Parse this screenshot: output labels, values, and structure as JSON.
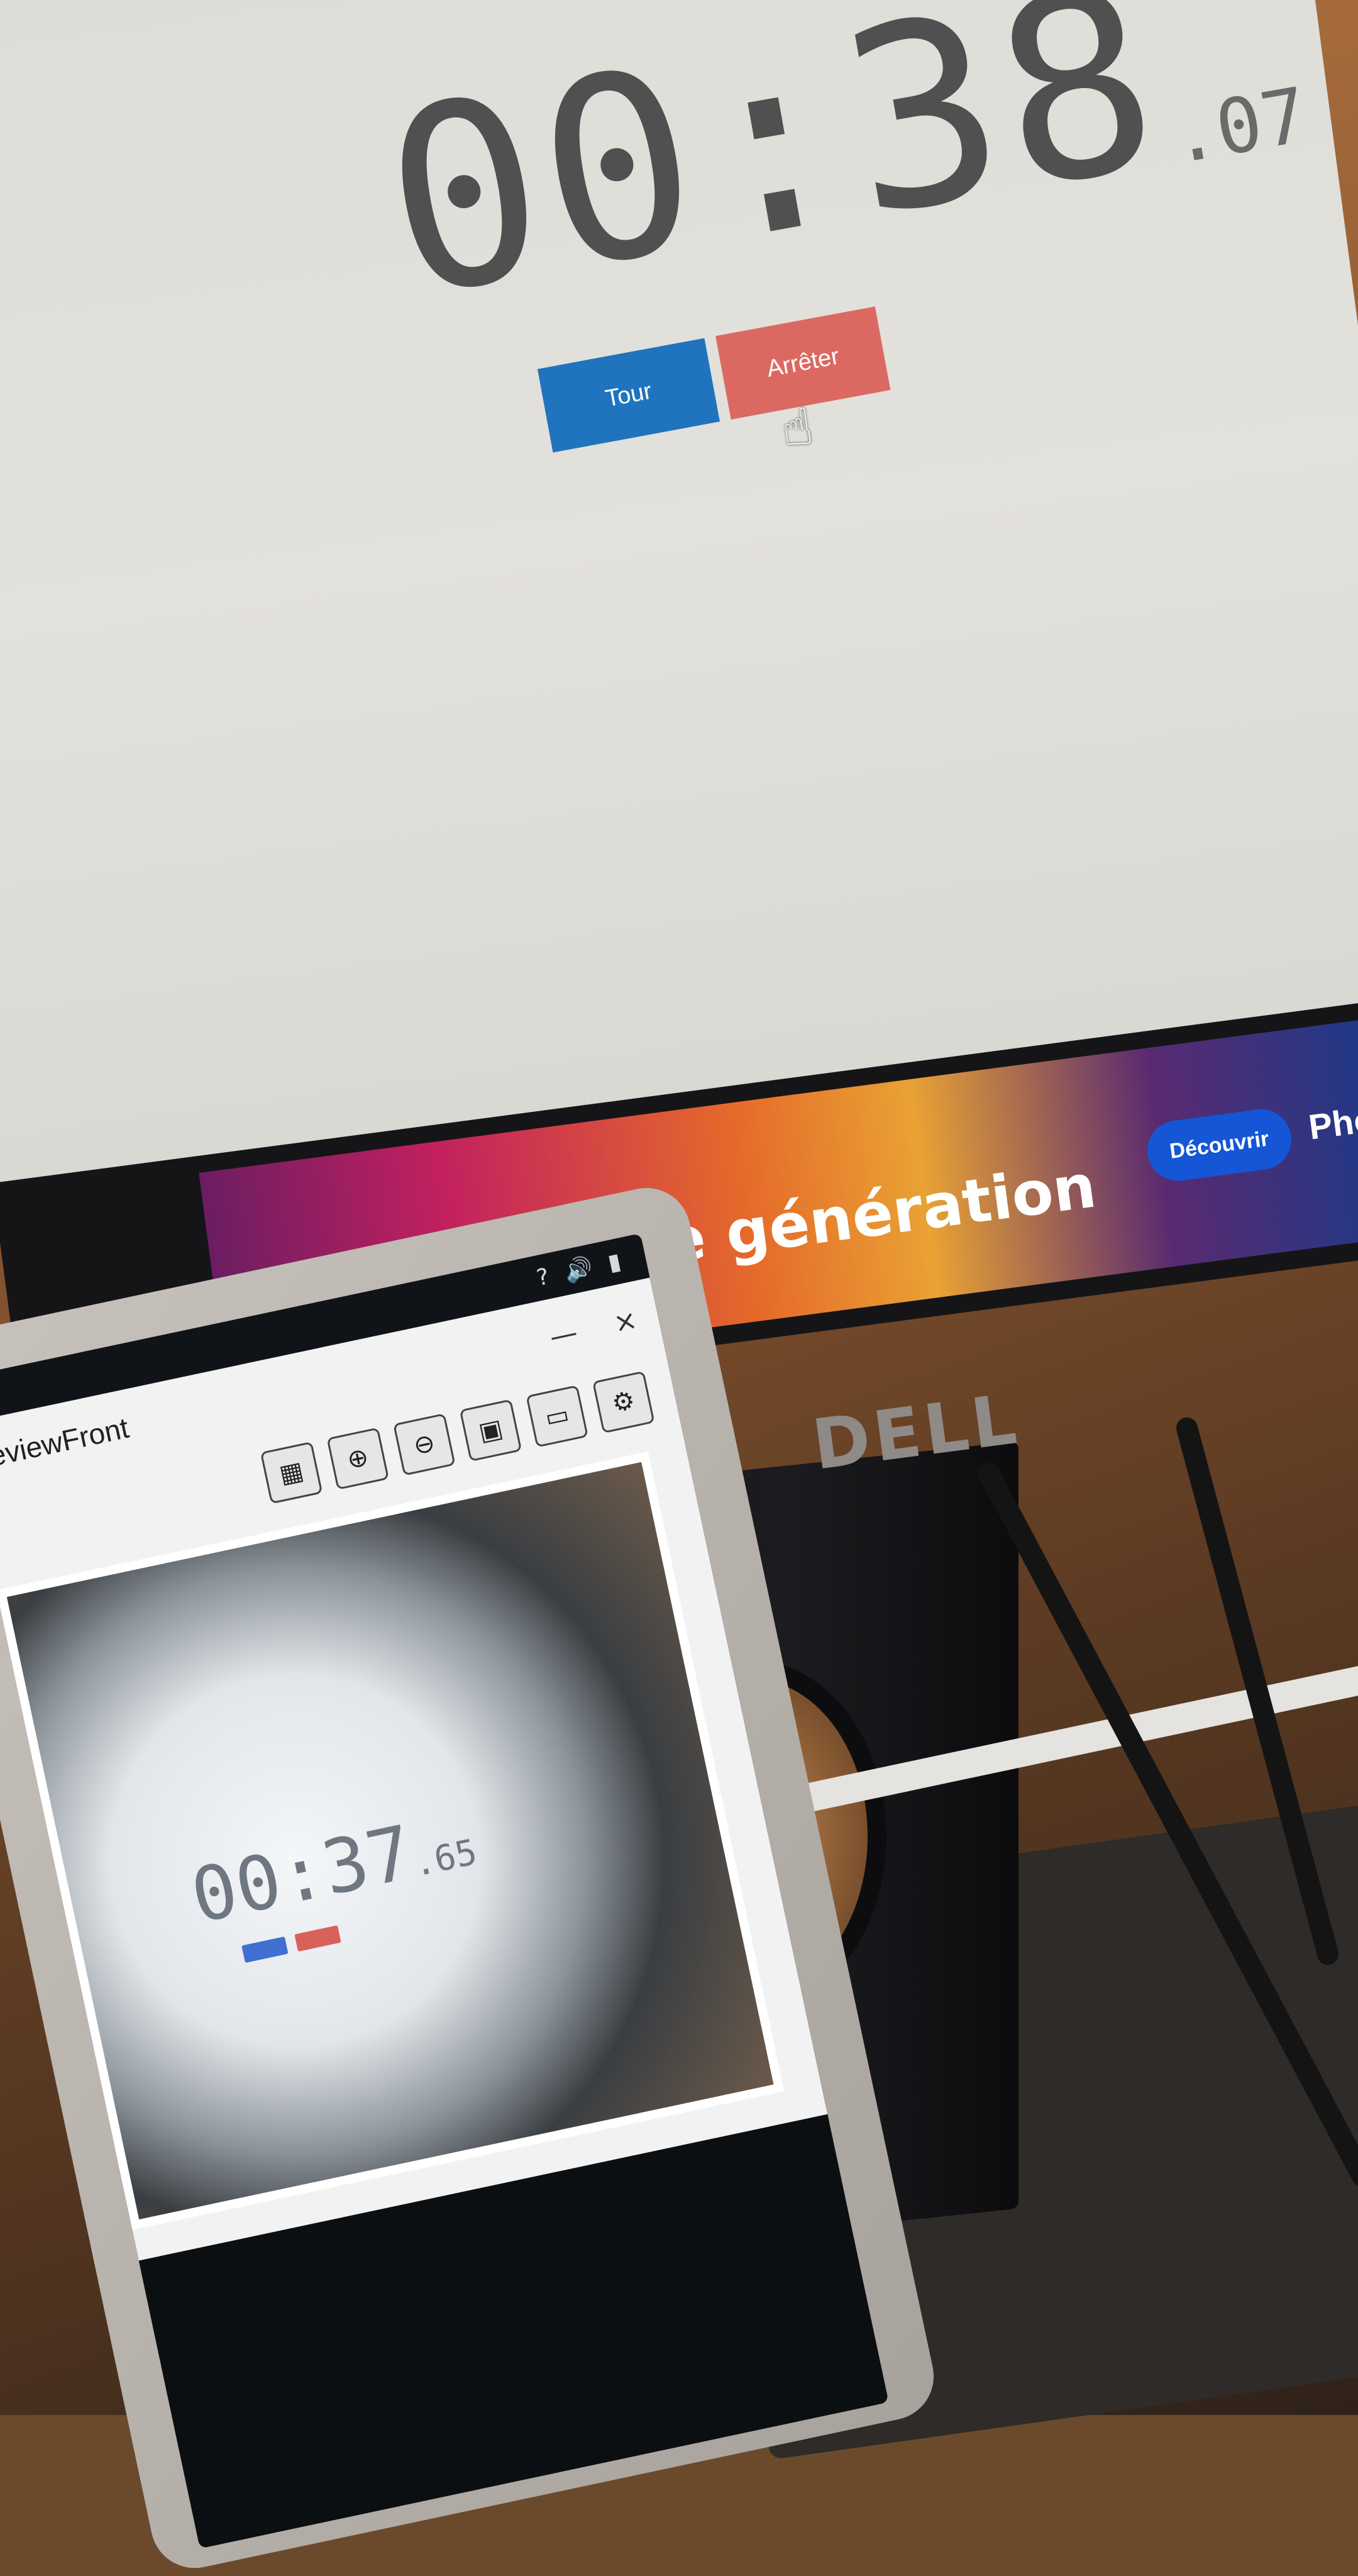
{
  "scene": "Photo of a Dell monitor displaying a stopwatch page, with a tablet in the foreground showing a camera preview of the same stopwatch",
  "monitor": {
    "brand": "DELL",
    "stopwatch": {
      "main": "00:38",
      "fraction": ".07"
    },
    "buttons": {
      "lap": "Tour",
      "stop": "Arrêter"
    },
    "colors": {
      "lap": "#1f74bd",
      "stop": "#dc6961",
      "digits": "#505050"
    },
    "ad_banner": {
      "headline": "L'IA nouvelle génération",
      "cta": "Découvrir",
      "trailing_text": "Pho"
    }
  },
  "tablet": {
    "window_title": "eviewFront",
    "status_icons": [
      "help-icon",
      "volume-icon",
      "battery-icon"
    ],
    "window_controls": [
      "—",
      "×"
    ],
    "toolbar_icons": [
      "gallery-icon",
      "zoom-in-icon",
      "zoom-out-icon",
      "save-icon",
      "folder-icon",
      "settings-icon"
    ],
    "preview_stopwatch": {
      "main": "00:37",
      "fraction": ".65"
    }
  }
}
